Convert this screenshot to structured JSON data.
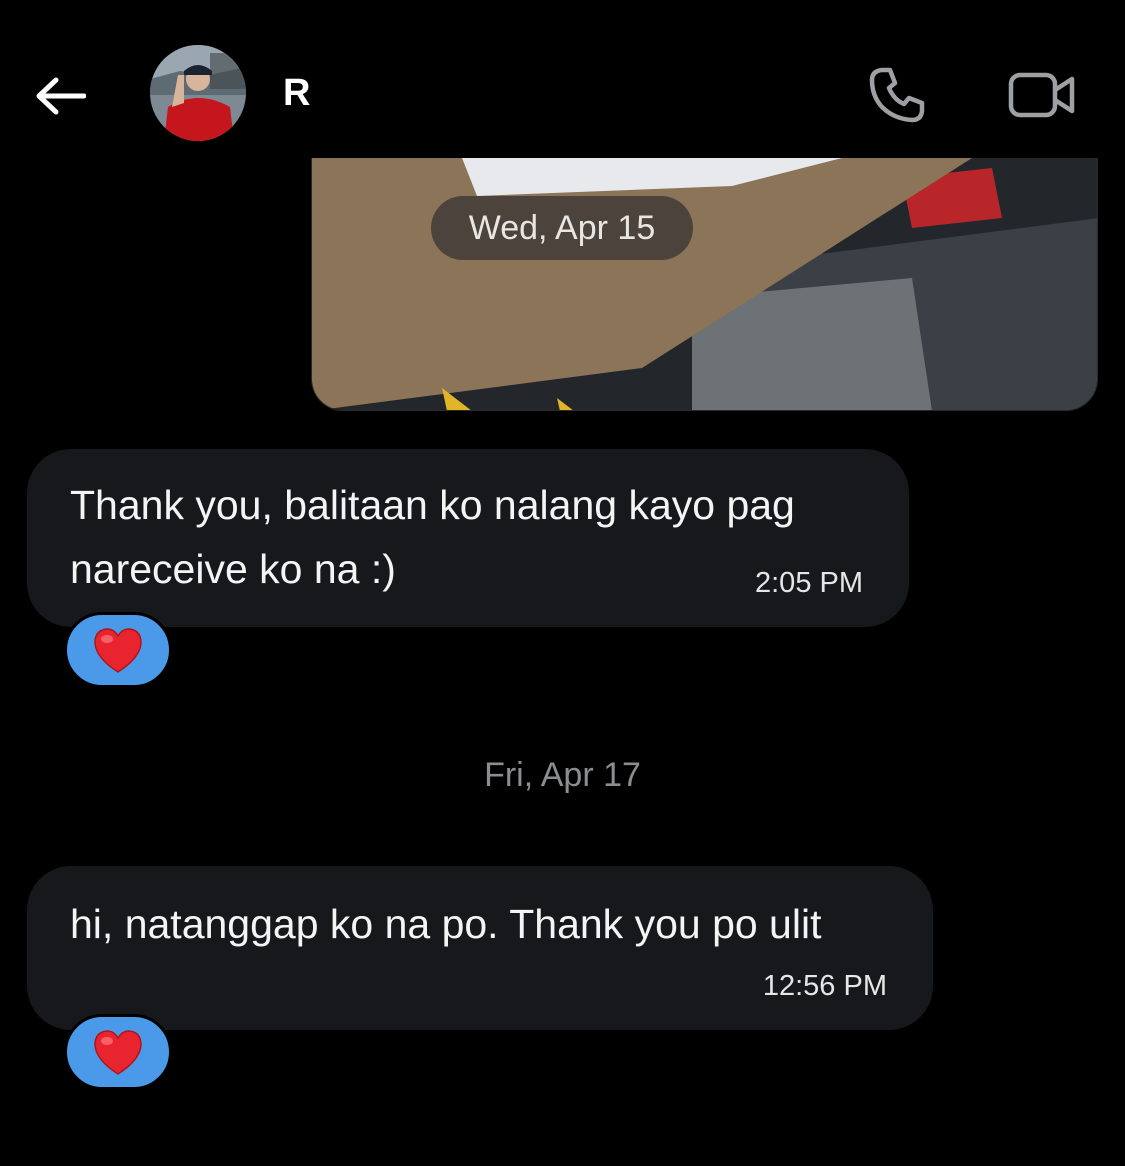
{
  "header": {
    "contact_name": "R",
    "back_icon": "arrow-left-icon",
    "call_icon": "phone-icon",
    "video_icon": "video-camera-icon"
  },
  "photo_message": {
    "date_chip": "Wed, Apr 15"
  },
  "messages": [
    {
      "text": "Thank you, balitaan ko nalang kayo pag nareceive ko na :)",
      "time": "2:05 PM",
      "reaction": "❤️"
    },
    {
      "text": "hi, natanggap ko na po. Thank you po ulit",
      "time": "12:56 PM",
      "reaction": "❤️"
    }
  ],
  "date_separator": "Fri, Apr 17",
  "colors": {
    "background": "#000000",
    "bubble": "#17181c",
    "reaction_bg": "#4a9ae9",
    "muted_text": "#8b8d90"
  }
}
